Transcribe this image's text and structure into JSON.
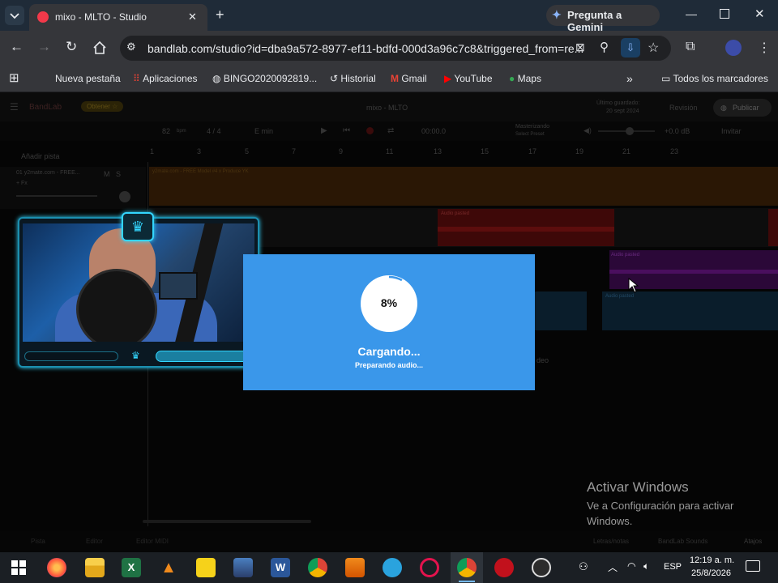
{
  "browser": {
    "tab": {
      "title": "mixo - MLTO - Studio",
      "close": "✕"
    },
    "new_tab": "+",
    "gemini": "Pregunta a Gemini",
    "url": "bandlab.com/studio?id=dba9a572-8977-ef11-bdfd-000d3a96c7c8&triggered_from=re...",
    "bookmarks": [
      {
        "label": "Nueva pestaña",
        "icon": "globe-icon"
      },
      {
        "label": "Aplicaciones",
        "icon": "apps-grid-icon"
      },
      {
        "label": "BINGO2020092819...",
        "icon": "globe-icon"
      },
      {
        "label": "Historial",
        "icon": "history-icon"
      },
      {
        "label": "Gmail",
        "icon": "gmail-icon"
      },
      {
        "label": "YouTube",
        "icon": "youtube-icon"
      },
      {
        "label": "Maps",
        "icon": "maps-pin-icon"
      }
    ],
    "all_bookmarks": "Todos los marcadores"
  },
  "studio": {
    "logo": "BandLab",
    "get_pro": "Obtener ☆",
    "project_title": "mixo - MLTO",
    "saved_info": [
      "Último guardado:",
      "20 sept 2024"
    ],
    "publish": "Publicar",
    "revision": "Revisión",
    "bpm": "82",
    "bpm_unit": "bpm",
    "time_sig": "4 / 4",
    "key": "E min",
    "time": "00:00.0",
    "mastering": [
      "Masterizando",
      "Select Preset"
    ],
    "db": "+0.0 dB",
    "invite": "Invitar",
    "add_track": "Añadir pista",
    "track1": {
      "name": "01  y2mate.com - FREE...",
      "m": "M",
      "s": "S",
      "fx": "+ Fx"
    },
    "track1_region": "y2mate.com - FREE Model #4 x Produce YK",
    "ruler": [
      "1",
      "3",
      "5",
      "7",
      "9",
      "11",
      "13",
      "15",
      "17",
      "19",
      "21",
      "23"
    ],
    "audio_regions": [
      "Audio pasted",
      "Audio pasted",
      "Audio pasted"
    ],
    "video_hint": "deo",
    "bottom": [
      "Pista",
      "Editor",
      "Editor MIDI"
    ],
    "bottom_right": [
      "Letras/notas",
      "BandLab Sounds",
      "Atajos"
    ]
  },
  "loader": {
    "percent": "8%",
    "progress": 0.08,
    "title": "Cargando...",
    "subtitle": "Preparando audio..."
  },
  "watermark": {
    "title": "Activar Windows",
    "line": "Ve a Configuración para activar Windows."
  },
  "taskbar": {
    "time": "12:19 a. m.",
    "date": "25/8/2026",
    "lang": "ESP",
    "apps": [
      "windows-start-icon",
      "firefox-icon",
      "file-explorer-icon",
      "excel-icon",
      "vlc-icon",
      "player-icon",
      "photos-icon",
      "word-icon",
      "chrome-icon",
      "fl-studio-icon",
      "telegram-icon",
      "opera-icon",
      "chrome-active-icon",
      "record-icon",
      "obs-icon"
    ]
  },
  "colors": {
    "loader_bg": "#3a97ea",
    "accent_cyan": "#33d6ff",
    "region_red": "#7a0f0f",
    "region_purple": "#55106a",
    "region_blue": "#0f2a3e",
    "region_orange": "#2a1705"
  }
}
